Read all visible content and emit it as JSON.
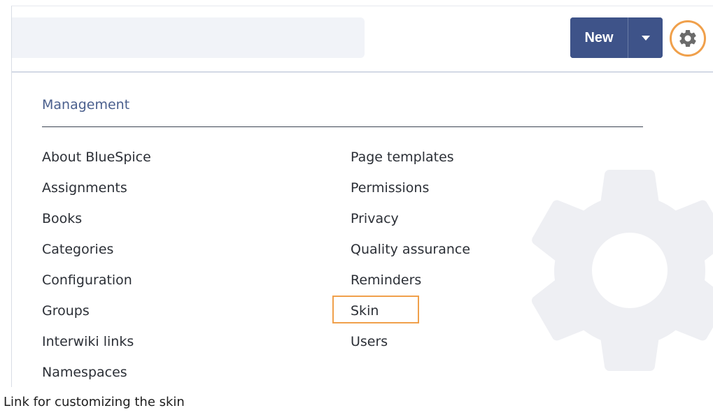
{
  "header": {
    "new_label": "New"
  },
  "management": {
    "title": "Management",
    "left_items": [
      "About BlueSpice",
      "Assignments",
      "Books",
      "Categories",
      "Configuration",
      "Groups",
      "Interwiki links",
      "Namespaces"
    ],
    "right_items": [
      "Page templates",
      "Permissions",
      "Privacy",
      "Quality assurance",
      "Reminders",
      "Skin",
      "Users"
    ],
    "highlighted_item": "Skin"
  },
  "caption": "Link for customizing the skin",
  "icons": {
    "settings": "gear-icon",
    "dropdown": "caret-down-icon",
    "background": "gear-watermark-icon"
  },
  "colors": {
    "primary": "#3e5389",
    "highlight": "#f0a04b",
    "heading": "#4a5f8d"
  }
}
